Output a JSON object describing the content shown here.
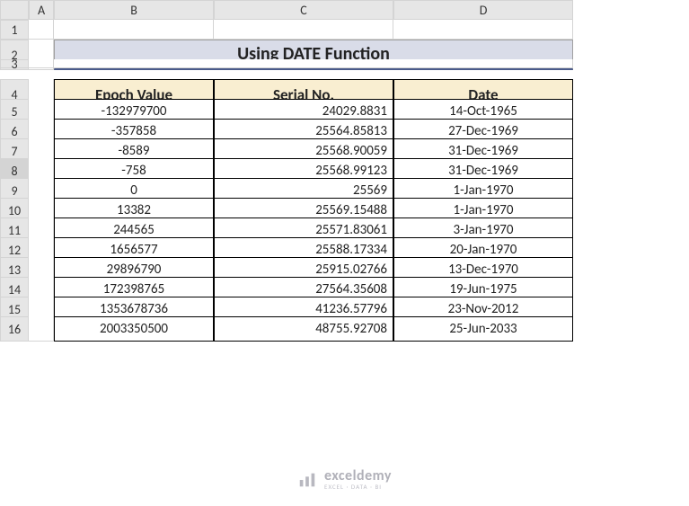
{
  "columns": [
    "A",
    "B",
    "C",
    "D"
  ],
  "row_numbers": [
    "1",
    "2",
    "3",
    "4",
    "5",
    "6",
    "7",
    "8",
    "9",
    "10",
    "11",
    "12",
    "13",
    "14",
    "15",
    "16"
  ],
  "active_row": "8",
  "title": "Using DATE Function",
  "headers": {
    "b": "Epoch Value",
    "c": "Serial No.",
    "d": "Date"
  },
  "chart_data": {
    "type": "table",
    "title": "Using DATE Function",
    "columns": [
      "Epoch Value",
      "Serial No.",
      "Date"
    ],
    "rows": [
      {
        "epoch": "-132979700",
        "serial": "24029.8831",
        "date": "14-Oct-1965"
      },
      {
        "epoch": "-357858",
        "serial": "25564.85813",
        "date": "27-Dec-1969"
      },
      {
        "epoch": "-8589",
        "serial": "25568.90059",
        "date": "31-Dec-1969"
      },
      {
        "epoch": "-758",
        "serial": "25568.99123",
        "date": "31-Dec-1969"
      },
      {
        "epoch": "0",
        "serial": "25569",
        "date": "1-Jan-1970"
      },
      {
        "epoch": "13382",
        "serial": "25569.15488",
        "date": "1-Jan-1970"
      },
      {
        "epoch": "244565",
        "serial": "25571.83061",
        "date": "3-Jan-1970"
      },
      {
        "epoch": "1656577",
        "serial": "25588.17334",
        "date": "20-Jan-1970"
      },
      {
        "epoch": "29896790",
        "serial": "25915.02766",
        "date": "13-Dec-1970"
      },
      {
        "epoch": "172398765",
        "serial": "27564.35608",
        "date": "19-Jun-1975"
      },
      {
        "epoch": "1353678736",
        "serial": "41236.57796",
        "date": "23-Nov-2012"
      },
      {
        "epoch": "2003350500",
        "serial": "48755.92708",
        "date": "25-Jun-2033"
      }
    ]
  },
  "logo": {
    "name": "exceldemy",
    "tagline": "EXCEL · DATA · BI"
  }
}
